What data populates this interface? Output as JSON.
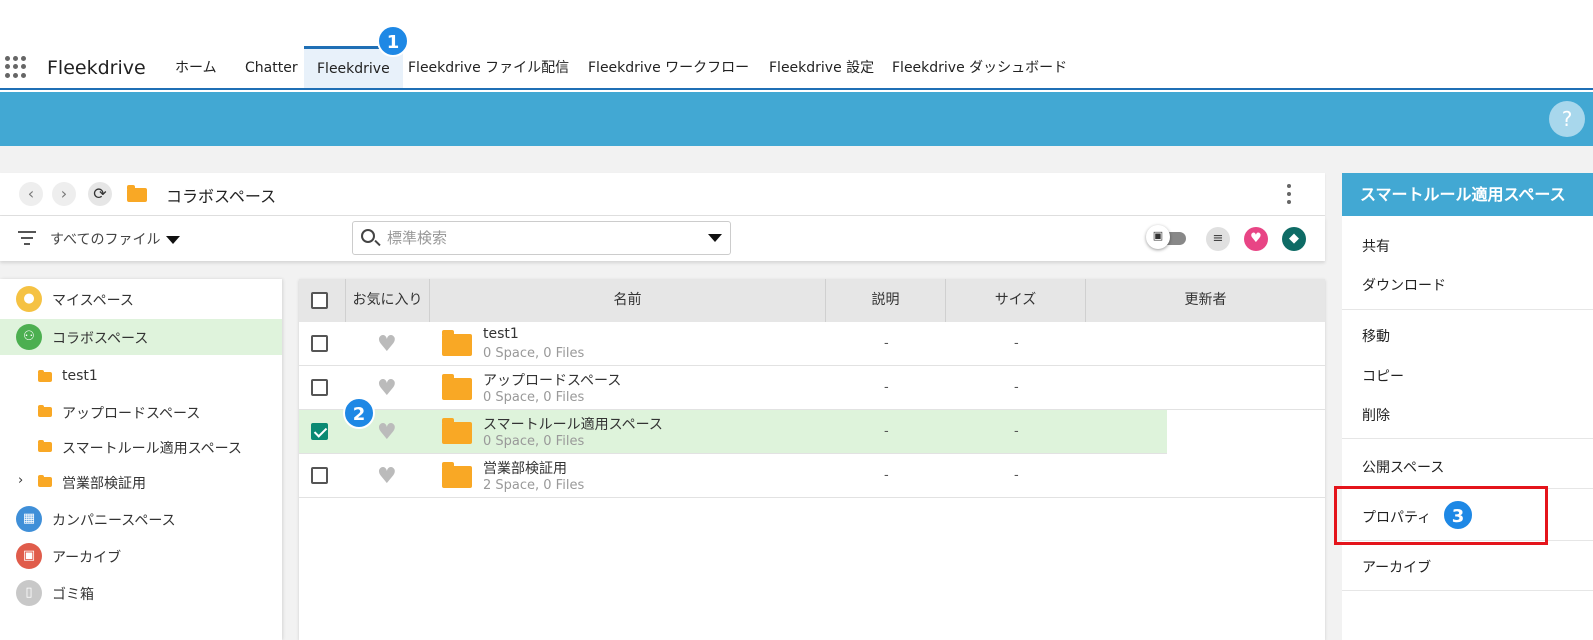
{
  "app": {
    "name": "Fleekdrive"
  },
  "nav": {
    "tabs": [
      {
        "label": "ホーム"
      },
      {
        "label": "Chatter"
      },
      {
        "label": "Fleekdrive"
      },
      {
        "label": "Fleekdrive ファイル配信"
      },
      {
        "label": "Fleekdrive ワークフロー"
      },
      {
        "label": "Fleekdrive 設定"
      },
      {
        "label": "Fleekdrive ダッシュボード"
      }
    ],
    "active_tab": "Fleekdrive"
  },
  "help": {
    "label": "?"
  },
  "badges": {
    "b1": "1",
    "b2": "2",
    "b3": "3"
  },
  "breadcrumb": {
    "current": "コラボスペース"
  },
  "filter": {
    "label": "すべてのファイル"
  },
  "search": {
    "placeholder": "標準検索"
  },
  "sidebar": {
    "items": [
      {
        "label": "マイスペース",
        "icon": "person-icon",
        "color": "#f5c243"
      },
      {
        "label": "コラボスペース",
        "icon": "group-icon",
        "color": "#4caf50"
      },
      {
        "label": "test1"
      },
      {
        "label": "アップロードスペース"
      },
      {
        "label": "スマートルール適用スペース"
      },
      {
        "label": "営業部検証用"
      },
      {
        "label": "カンパニースペース",
        "icon": "building-icon",
        "color": "#3f8fd8"
      },
      {
        "label": "アーカイブ",
        "icon": "archive-icon",
        "color": "#e05c4b"
      },
      {
        "label": "ゴミ箱",
        "icon": "trash-icon",
        "color": "#c8c8c8"
      }
    ]
  },
  "table": {
    "headers": {
      "favorite": "お気に入り",
      "name": "名前",
      "description": "説明",
      "size": "サイズ",
      "updater": "更新者"
    },
    "rows": [
      {
        "name": "test1",
        "meta": "0 Space, 0 Files",
        "description": "-",
        "size": "-",
        "checked": false
      },
      {
        "name": "アップロードスペース",
        "meta": "0 Space, 0 Files",
        "description": "-",
        "size": "-",
        "checked": false
      },
      {
        "name": "スマートルール適用スペース",
        "meta": "0 Space, 0 Files",
        "description": "-",
        "size": "-",
        "checked": true
      },
      {
        "name": "営業部検証用",
        "meta": "2 Space, 0 Files",
        "description": "-",
        "size": "-",
        "checked": false
      }
    ]
  },
  "right_panel": {
    "title": "スマートルール適用スペース",
    "items": [
      {
        "label": "共有"
      },
      {
        "label": "ダウンロード"
      },
      {
        "label": "移動"
      },
      {
        "label": "コピー"
      },
      {
        "label": "削除"
      },
      {
        "label": "公開スペース"
      },
      {
        "label": "プロパティ"
      },
      {
        "label": "アーカイブ"
      }
    ]
  },
  "colors": {
    "accent": "#42a8d3",
    "nav_border": "#1f6fb5",
    "selected_row": "#def3db",
    "highlight_box": "#e4141b",
    "badge": "#1e88e5"
  }
}
